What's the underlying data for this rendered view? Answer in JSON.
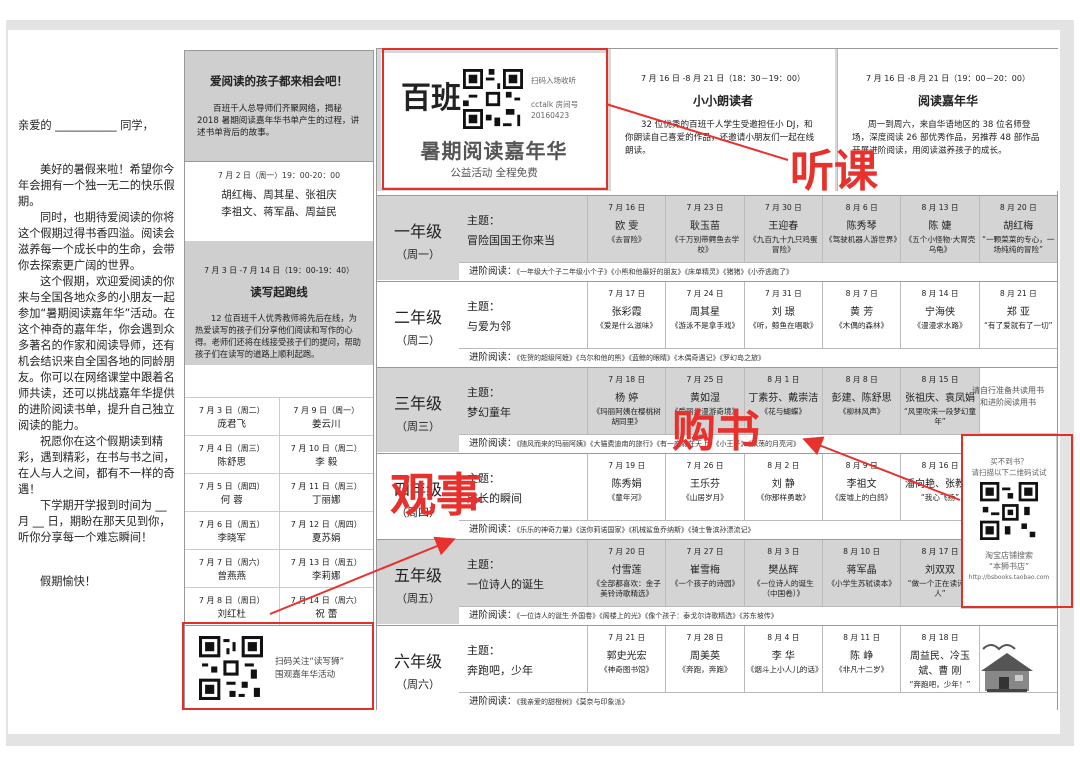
{
  "letter": {
    "greeting": "亲爱的 ___________ 同学，",
    "p1": "美好的暑假来啦！希望你今年会拥有一个独一无二的快乐假期。",
    "p2": "同时，也期待爱阅读的你将这个假期过得书香四溢。阅读会滋养每一个成长中的生命，会带你去探索更广阔的世界。",
    "p3": "这个假期，欢迎爱阅读的你来与全国各地众多的小朋友一起参加“暑期阅读嘉年华”活动。在这个神奇的嘉年华，你会遇到众多著名的作家和阅读导师，还有机会结识来自全国各地的同龄朋友。你可以在网络课堂中跟着名师共读，还可以挑战嘉年华提供的进阶阅读书单，提升自己独立阅读的能力。",
    "p4": "祝愿你在这个假期读到精彩，遇到精彩，在书与书之间，在人与人之间，都有不一样的奇遇！",
    "p5": "下学期开学报到时间为 __ 月 __ 日，期盼在那天见到你，听你分享每一个难忘瞬间！",
    "closing": "假期愉快！"
  },
  "intro": {
    "title": "爱阅读的孩子都来相会吧！",
    "desc": "百班千人总导师们齐聚网络，揭秘2018 暑期阅读嘉年华书单产生的过程，讲述书单背后的故事。",
    "date": "7 月 2 日（周一）19：00-20：00",
    "names1": "胡红梅、周其星、张祖庆",
    "names2": "李祖文、蒋军晶、周益民"
  },
  "relay": {
    "date": "7 月 3 日 -7 月 14 日（19：00-19：40）",
    "title": "读写起跑线",
    "desc": "12 位百班千人优秀教师将先后在线，为热爱读写的孩子们分享他们阅读和写作的心得。老师们还将在线接受孩子们的提问，帮助孩子们在读写的道路上顺利起跑。",
    "rows": [
      [
        {
          "d": "7 月 3 日（周二）",
          "n": "庞君飞"
        },
        {
          "d": "7 月 9 日（周一）",
          "n": "姜云川"
        }
      ],
      [
        {
          "d": "7 月 4 日（周三）",
          "n": "陈舒思"
        },
        {
          "d": "7 月 10 日（周二）",
          "n": "李  毅"
        }
      ],
      [
        {
          "d": "7 月 5 日（周四）",
          "n": "何  蓉"
        },
        {
          "d": "7 月 11 日（周三）",
          "n": "丁丽娜"
        }
      ],
      [
        {
          "d": "7 月 6 日（周五）",
          "n": "李晓军"
        },
        {
          "d": "7 月 12 日（周四）",
          "n": "夏苏娟"
        }
      ],
      [
        {
          "d": "7 月 7 日（周六）",
          "n": "曾燕燕"
        },
        {
          "d": "7 月 13 日（周五）",
          "n": "李莉娜"
        }
      ],
      [
        {
          "d": "7 月 8 日（周日）",
          "n": "刘红杜"
        },
        {
          "d": "7 月 14 日（周六）",
          "n": "祝  蕾"
        }
      ]
    ],
    "qr_text1": "扫码关注“读写狮”",
    "qr_text2": "围观嘉年华活动"
  },
  "header": {
    "logo_char": "百班",
    "scan": "扫码入场收听",
    "acct1": "cctalk 房间号",
    "acct2": "20160423",
    "title": "暑期阅读嘉年华",
    "sub": "公益活动   全程免费",
    "ev1_date": "7 月 16 日 -8 月 21 日（18：30－19：00）",
    "ev1_title": "小小朗读者",
    "ev1_desc": "32 位优秀的百班千人学生受邀担任小 DJ，和你朗读自己喜爱的作品，还邀请小朋友们一起在线朗读。",
    "ev2_date": "7 月 16 日 -8 月 21 日（19：00－20：00）",
    "ev2_title": "阅读嘉年华",
    "ev2_desc": "周一到周六，来自华语地区的 38 位名师登场，深度阅读 26 部优秀作品，另推荐 48 部作品开展进阶阅读，用阅读滋养孩子的成长。"
  },
  "grades": [
    {
      "name": "一年级",
      "week": "（周一）",
      "th": "冒险国国王你来当",
      "cells": [
        {
          "d": "7 月 16 日",
          "n": "欧  雯",
          "b": "《去冒险》"
        },
        {
          "d": "7 月 23 日",
          "n": "耿玉苗",
          "b": "《千万别带鳄鱼去学校》"
        },
        {
          "d": "7 月 30 日",
          "n": "王迎春",
          "b": "《九百九十九只鸡蛋冒险》"
        },
        {
          "d": "8 月 6 日",
          "n": "陈秀琴",
          "b": "《驾驶机器人游世界》"
        },
        {
          "d": "8 月 13 日",
          "n": "陈  婕",
          "b": "《五个小怪物·大胃壳乌龟》"
        },
        {
          "d": "8 月 20 日",
          "n": "胡红梅",
          "b": "“一颗菜菜的专心，一场纯纯的冒险”"
        }
      ],
      "adv": "《一年级大个子二年级小个子》《小熊和他最好的朋友》《床单精灵》《猪猪》《小乔逃跑了》"
    },
    {
      "name": "二年级",
      "week": "（周二）",
      "th": "与爱为邻",
      "cells": [
        {
          "d": "7 月 17 日",
          "n": "张彩霞",
          "b": "《爱是什么滋味》"
        },
        {
          "d": "7 月 24 日",
          "n": "周其星",
          "b": "《游泳不是拿手戏》"
        },
        {
          "d": "7 月 31 日",
          "n": "刘  璟",
          "b": "《听，鲸鱼在唱歌》"
        },
        {
          "d": "8 月 7 日",
          "n": "黄  芳",
          "b": "《木偶的森林》"
        },
        {
          "d": "8 月 14 日",
          "n": "宁海侠",
          "b": "《漫漫求水路》"
        },
        {
          "d": "8 月 21 日",
          "n": "郑  亚",
          "b": "“有了爱就有了一切”"
        }
      ],
      "adv": "《佐贺的超级阿嬷》《乌尔和他的熊》《蓝鲸的眼睛》《木偶奇遇记》《罗幻岛之旅》"
    },
    {
      "name": "三年级",
      "week": "（周三）",
      "th": "梦幻童年",
      "cells": [
        {
          "d": "7 月 18 日",
          "n": "杨  婷",
          "b": "《玛丽阿姨在樱桃树胡同里》"
        },
        {
          "d": "7 月 25 日",
          "n": "黄如湿",
          "b": "《爱丽丝漫游奇境》"
        },
        {
          "d": "8 月 1 日",
          "n": "丁素芬、戴崇洁",
          "b": "《花与蝴蝶》"
        },
        {
          "d": "8 月 8 日",
          "n": "彭建、陈舒思",
          "b": "《柳林风声》"
        },
        {
          "d": "8 月 15 日",
          "n": "张祖庆、袁凤娟",
          "b": "“风里吹来一段梦幻童年”"
        }
      ],
      "adv": "《随风而来的玛丽阿姨》《大猫费迪南的旅行》《有一座城在天上》《小王子》《飘荡的月亮河》"
    },
    {
      "name": "四年级",
      "week": "（周四）",
      "th": "成长的瞬间",
      "cells": [
        {
          "d": "7 月 19 日",
          "n": "陈秀娟",
          "b": "《童年河》"
        },
        {
          "d": "7 月 26 日",
          "n": "王乐芬",
          "b": "《山居岁月》"
        },
        {
          "d": "8 月 2 日",
          "n": "刘  静",
          "b": "《你那样勇敢》"
        },
        {
          "d": "8 月 9 日",
          "n": "李祖文",
          "b": "《废墟上的白鸽》"
        },
        {
          "d": "8 月 16 日",
          "n": "潘向艳、张教华",
          "b": "“我心飞扬”"
        }
      ],
      "adv": "《乐乐的神奇力量》《送你莉诺国家》《机械鲨鱼乔纳斯》《骑士鲁滨孙漂流记》"
    },
    {
      "name": "五年级",
      "week": "（周五）",
      "th": "一位诗人的诞生",
      "cells": [
        {
          "d": "7 月 20 日",
          "n": "付雪莲",
          "b": "《全部都喜欢：金子美铃诗歌精选》"
        },
        {
          "d": "7 月 27 日",
          "n": "崔雪梅",
          "b": "《一个孩子的诗园》"
        },
        {
          "d": "8 月 3 日",
          "n": "樊丛辉",
          "b": "《一位诗人的诞生（中国卷）》"
        },
        {
          "d": "8 月 10 日",
          "n": "蒋军晶",
          "b": "《小学生苏轼读本》"
        },
        {
          "d": "8 月 17 日",
          "n": "刘双双",
          "b": "“做一个正在读诗的人”"
        }
      ],
      "adv": "《一位诗人的诞生·外国卷》《阁楼上的光》《像个孩子：泰戈尔诗歌精选》《苏东坡传》"
    },
    {
      "name": "六年级",
      "week": "（周六）",
      "th": "奔跑吧，少年",
      "cells": [
        {
          "d": "7 月 21 日",
          "n": "郭史光宏",
          "b": "《神奇图书馆》"
        },
        {
          "d": "7 月 28 日",
          "n": "周美英",
          "b": "《奔跑，奔跑》"
        },
        {
          "d": "8 月 4 日",
          "n": "李  华",
          "b": "《烟斗上小人儿的话》"
        },
        {
          "d": "8 月 11 日",
          "n": "陈  峥",
          "b": "《非凡十二岁》"
        },
        {
          "d": "8 月 18 日",
          "n": "周益民、冷玉斌、曹  刚",
          "b": "“奔跑吧，少年！”"
        }
      ],
      "adv": "《我亲爱的甜橙树》《莫奈与印象派》"
    }
  ],
  "labels": {
    "theme": "主题：",
    "adv": "进阶阅读："
  },
  "side": {
    "note1": "请自行准备共读用书",
    "note2": "和进阶阅读用书",
    "ad1": "买不到书？",
    "ad2": "请扫描以下二维码试试",
    "ad3": "淘宝店铺搜索",
    "ad4": "“本狮书店”",
    "ad5": "http://bsbooks.taobao.com"
  },
  "overlay": {
    "tingke": "听课",
    "gouShu": "购书",
    "guanShi": "观事",
    "color": "#e8312c"
  }
}
